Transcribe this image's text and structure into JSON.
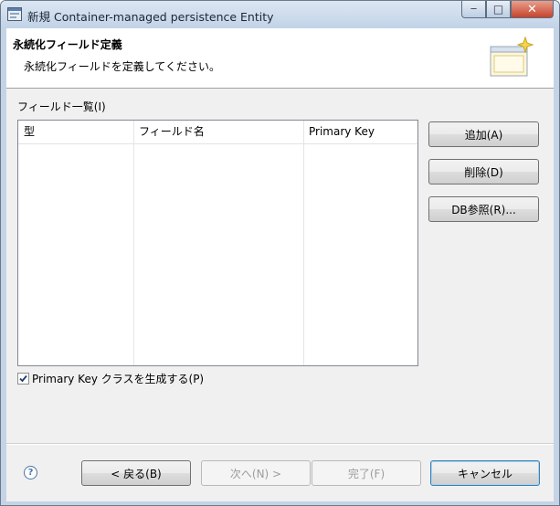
{
  "window": {
    "title": "新規 Container-managed persistence Entity",
    "min_glyph": "─",
    "max_glyph": "□",
    "close_glyph": "✕"
  },
  "header": {
    "title": "永続化フィールド定義",
    "description": "永続化フィールドを定義してください。"
  },
  "fields": {
    "label": "フィールド一覧(I)",
    "columns": [
      "型",
      "フィールド名",
      "Primary Key"
    ],
    "rows": []
  },
  "side_buttons": {
    "add": "追加(A)",
    "delete": "削除(D)",
    "db_ref": "DB参照(R)..."
  },
  "checkbox": {
    "label": "Primary Key クラスを生成する(P)",
    "checked": true
  },
  "footer": {
    "help_glyph": "?",
    "back": "< 戻る(B)",
    "next": "次へ(N) >",
    "finish": "完了(F)",
    "cancel": "キャンセル"
  },
  "icons": {
    "app": "app-window-icon",
    "wizard": "wizard-banner-icon",
    "help": "help-icon",
    "check": "checkmark-icon"
  },
  "colors": {
    "titlebar": "#c4d4e6",
    "close_button": "#c7432c",
    "client_bg": "#f0f0f0"
  }
}
